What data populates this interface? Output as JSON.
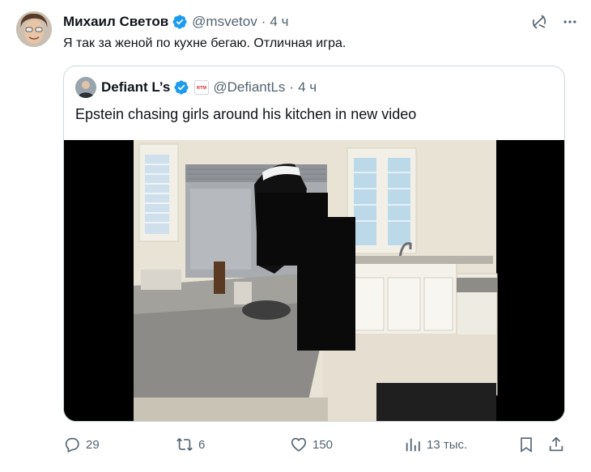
{
  "author": {
    "name": "Михаил Светов",
    "handle": "@msvetov",
    "separator": "·",
    "time": "4 ч",
    "verified": true
  },
  "tweet_text": "Я так за женой по кухне бегаю. Отличная игра.",
  "quote": {
    "name": "Defiant L’s",
    "badge_text": "RTM",
    "handle": "@DefiantLs",
    "separator": "·",
    "time": "4 ч",
    "text": "Epstein chasing girls around his kitchen in new video"
  },
  "actions": {
    "replies": "29",
    "reposts": "6",
    "likes": "150",
    "views": "13 тыс."
  },
  "colors": {
    "verified_blue": "#1d9bf0",
    "secondary_text": "#536471",
    "border": "#cfd9de"
  },
  "icons": [
    "grok-icon",
    "more-icon",
    "verified-icon",
    "reply-icon",
    "repost-icon",
    "like-icon",
    "views-icon",
    "bookmark-icon",
    "share-icon"
  ]
}
